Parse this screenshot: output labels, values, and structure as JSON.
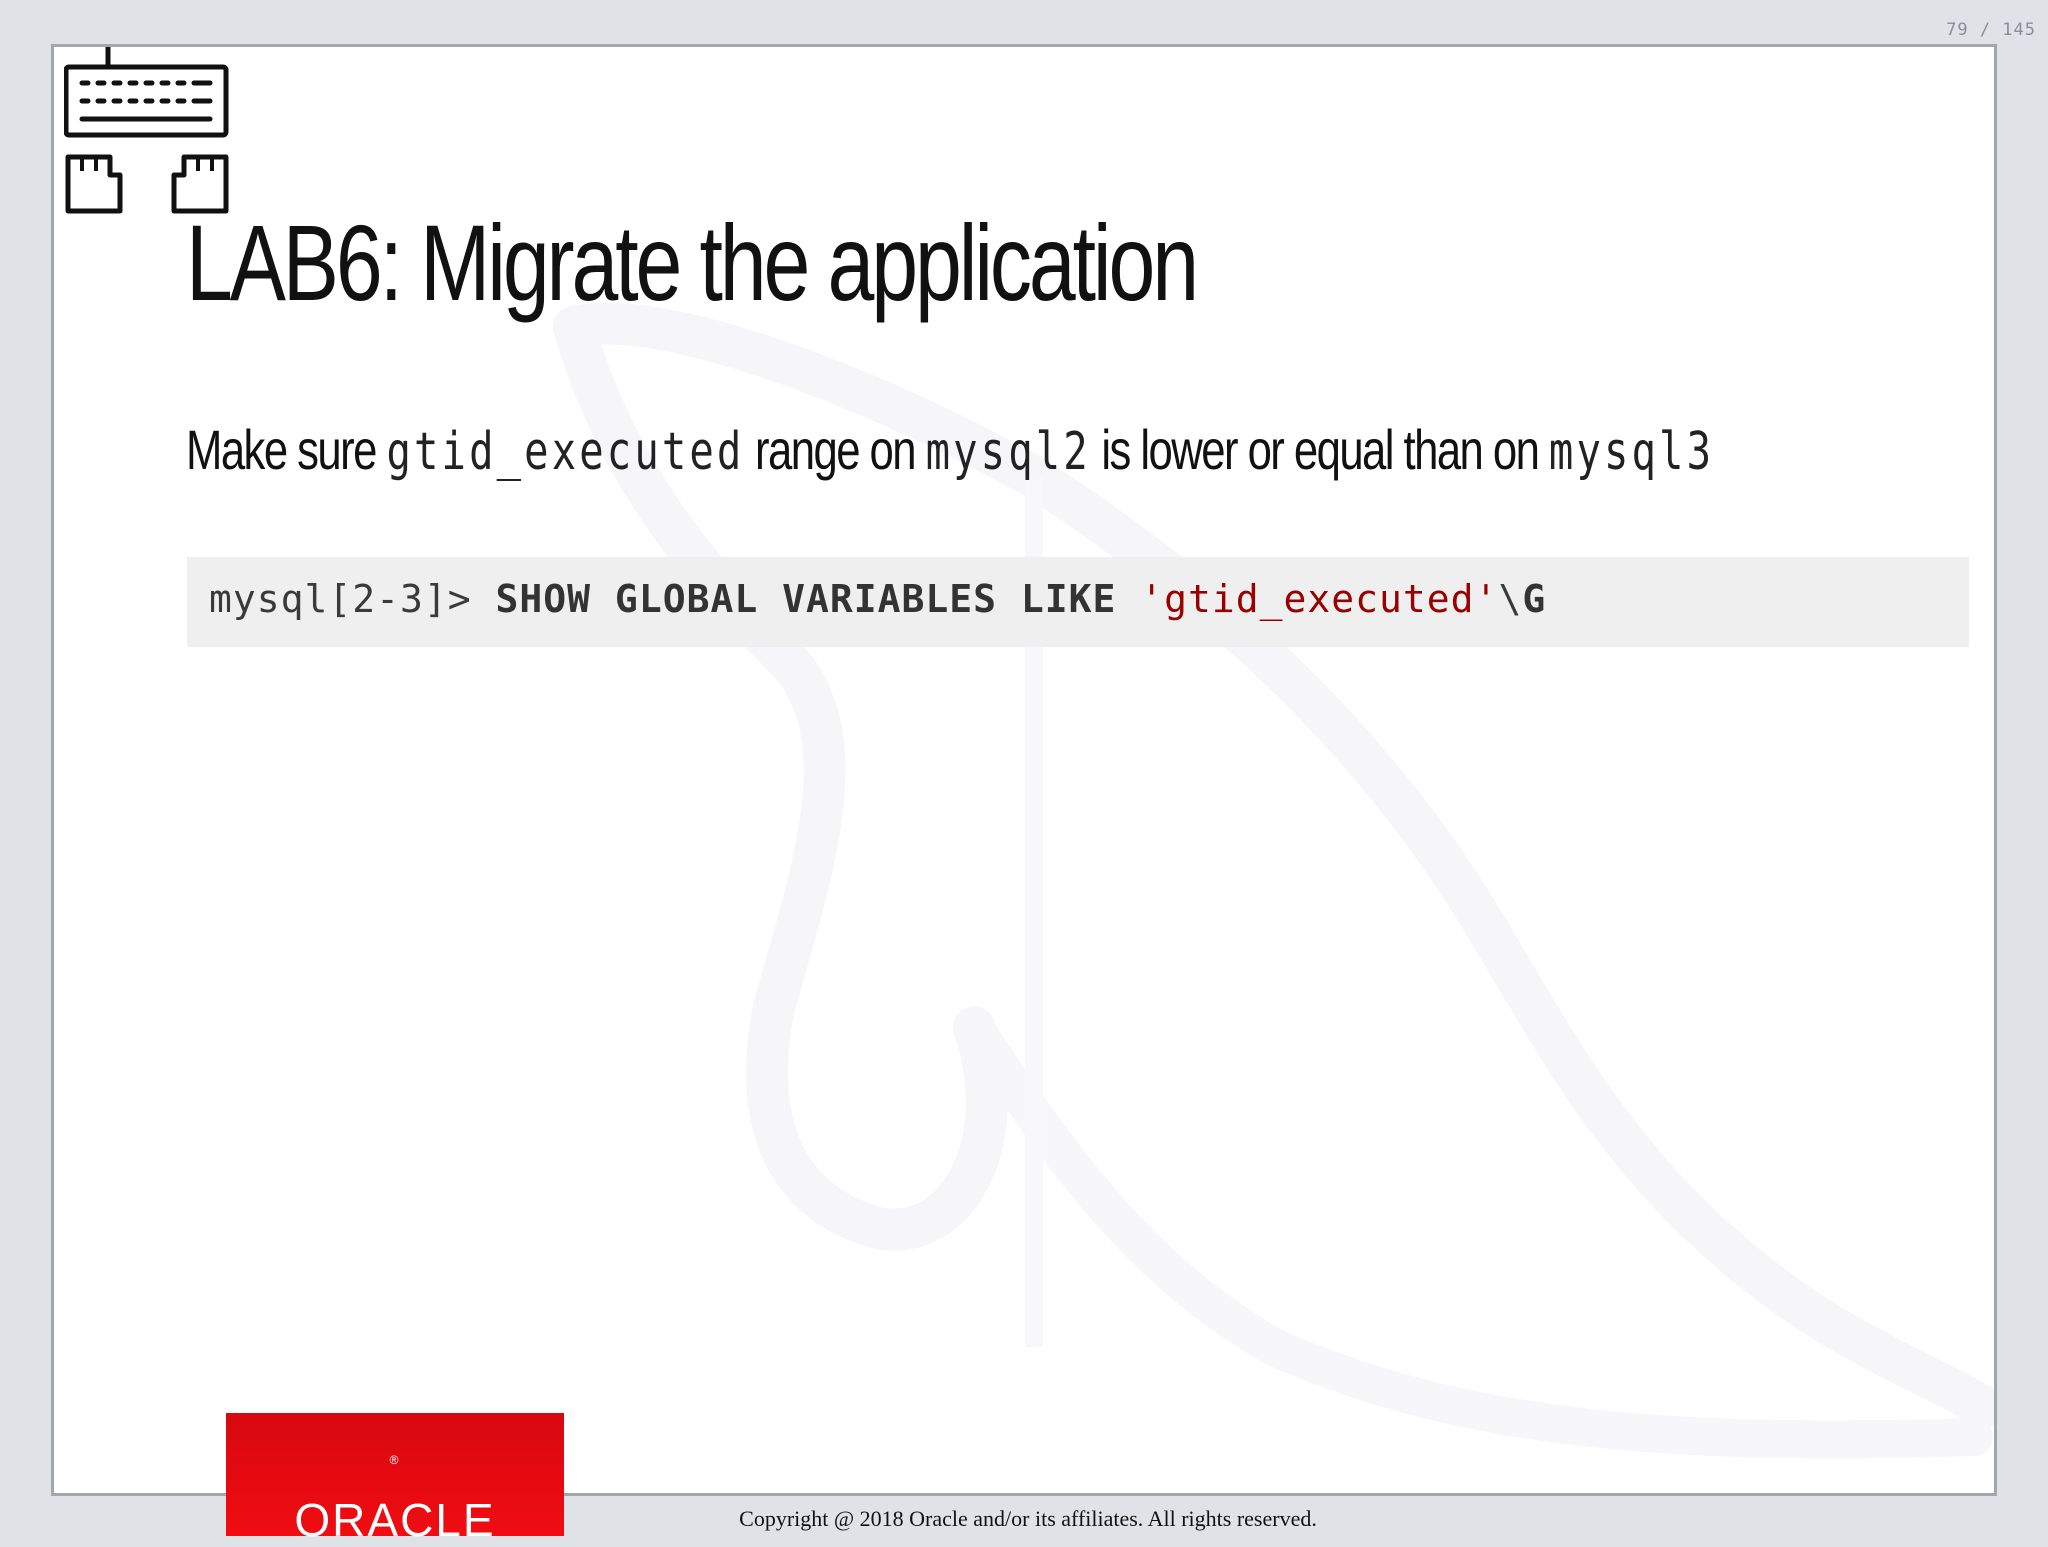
{
  "page_counter": "79 / 145",
  "slide": {
    "title": "LAB6: Migrate the application",
    "subtitle": {
      "t1": "Make sure ",
      "c1": "gtid_executed",
      "t2": " range on ",
      "c2": "mysql2",
      "t3": " is lower or equal than on ",
      "c3": "mysql3"
    },
    "code": {
      "prompt": "mysql[2-3]> ",
      "keywords": "SHOW GLOBAL VARIABLES LIKE ",
      "string": "'gtid_executed'",
      "terminator_bs": "\\",
      "terminator_g": "G"
    }
  },
  "footer": {
    "logo_text": "ORACLE",
    "logo_mark": "®",
    "copyright": "Copyright @ 2018 Oracle and/or its affiliates. All rights reserved."
  },
  "colors": {
    "background": "#dfe3e8",
    "slide": "#ffffff",
    "code_bg": "#efeff0",
    "string": "#990000",
    "oracle_red": "#e00b11"
  },
  "icons": {
    "top_left": "keyboard-hands-icon",
    "watermark": "mysql-dolphin-watermark"
  }
}
